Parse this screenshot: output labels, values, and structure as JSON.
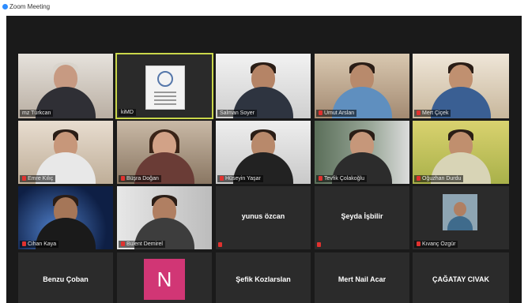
{
  "window": {
    "title": "Zoom Meeting"
  },
  "participants": [
    {
      "name": "mz Türkcan",
      "muted": false
    },
    {
      "name": "kiMD",
      "muted": false
    },
    {
      "name": "Salman Soyer",
      "muted": false
    },
    {
      "name": "Umut Arslan",
      "muted": true
    },
    {
      "name": "Mert Çiçek",
      "muted": true
    },
    {
      "name": "Emre Kılıç",
      "muted": true
    },
    {
      "name": "Büşra Doğan",
      "muted": true
    },
    {
      "name": "Hüseyin Yaşar",
      "muted": true
    },
    {
      "name": "Tevfik Çolakoğlu",
      "muted": true
    },
    {
      "name": "Oğuzhan Durdu",
      "muted": true
    },
    {
      "name": "Cihan Kaya",
      "muted": true
    },
    {
      "name": "Bülent Demirel",
      "muted": true
    },
    {
      "name": "yunus özcan",
      "muted": true
    },
    {
      "name": "Şeyda İşbilir",
      "muted": true
    },
    {
      "name": "Kıvanç Özgür",
      "muted": true
    },
    {
      "name": "Benzu Çoban",
      "muted": false
    },
    {
      "name": "N",
      "muted": false
    },
    {
      "name": "Şefik Kozlarslan",
      "muted": false
    },
    {
      "name": "Mert Nail Acar",
      "muted": false
    },
    {
      "name": "ÇAĞATAY CIVAK",
      "muted": false
    }
  ],
  "colors": {
    "active_speaker_border": "#c9d64a",
    "muted_icon": "#e0322f",
    "avatar_bg": "#d13675",
    "tile_bg": "#2b2b2b"
  }
}
